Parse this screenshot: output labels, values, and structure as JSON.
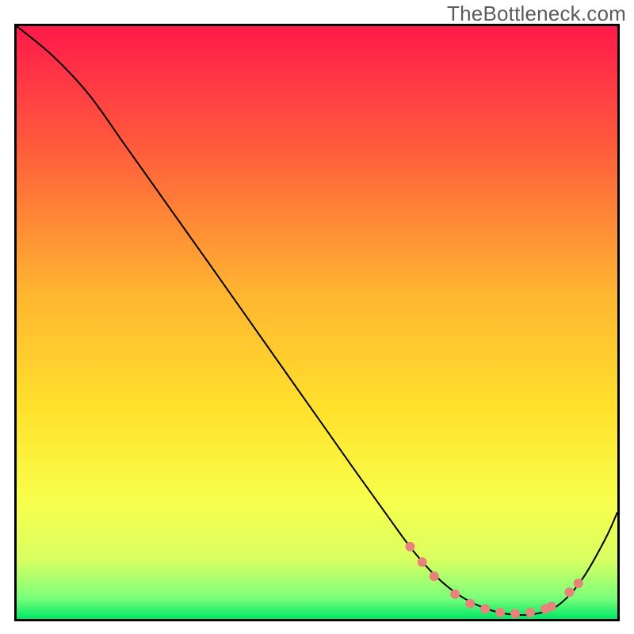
{
  "watermark": "TheBottleneck.com",
  "chart_data": {
    "type": "line",
    "title": "",
    "xlabel": "",
    "ylabel": "",
    "xlim": [
      0,
      100
    ],
    "ylim": [
      0,
      100
    ],
    "grid": false,
    "legend": false,
    "background_gradient": {
      "stops": [
        {
          "offset": 0.0,
          "color": "#ff1a4b"
        },
        {
          "offset": 0.2,
          "color": "#ff5a3c"
        },
        {
          "offset": 0.45,
          "color": "#ffb531"
        },
        {
          "offset": 0.65,
          "color": "#ffe22c"
        },
        {
          "offset": 0.8,
          "color": "#f8ff4c"
        },
        {
          "offset": 0.9,
          "color": "#d9ff62"
        },
        {
          "offset": 0.965,
          "color": "#7aff7a"
        },
        {
          "offset": 1.0,
          "color": "#00e765"
        }
      ]
    },
    "series": [
      {
        "name": "bottleneck-curve",
        "color": "#000000",
        "stroke_width": 2,
        "x": [
          0,
          6,
          12,
          18,
          25,
          32,
          40,
          48,
          56,
          62,
          66,
          70,
          74,
          78,
          82,
          86,
          90,
          94,
          98,
          100
        ],
        "y": [
          100,
          95,
          88.5,
          80,
          70,
          60,
          48.5,
          37,
          25.5,
          17,
          11.5,
          7,
          3.8,
          1.8,
          0.8,
          0.8,
          2.2,
          6.5,
          13.5,
          18
        ]
      }
    ],
    "markers": {
      "name": "pink-dots",
      "color": "#e8837b",
      "radius_px": 6,
      "points": [
        {
          "x": 65.5,
          "y": 12.2
        },
        {
          "x": 67.5,
          "y": 9.6
        },
        {
          "x": 69.5,
          "y": 7.2
        },
        {
          "x": 73.0,
          "y": 4.2
        },
        {
          "x": 75.5,
          "y": 2.6
        },
        {
          "x": 78.0,
          "y": 1.7
        },
        {
          "x": 80.5,
          "y": 1.1
        },
        {
          "x": 83.0,
          "y": 0.9
        },
        {
          "x": 85.5,
          "y": 1.1
        },
        {
          "x": 88.0,
          "y": 1.7
        },
        {
          "x": 89.0,
          "y": 2.1
        },
        {
          "x": 92.0,
          "y": 4.5
        },
        {
          "x": 93.5,
          "y": 6.0
        }
      ]
    }
  }
}
